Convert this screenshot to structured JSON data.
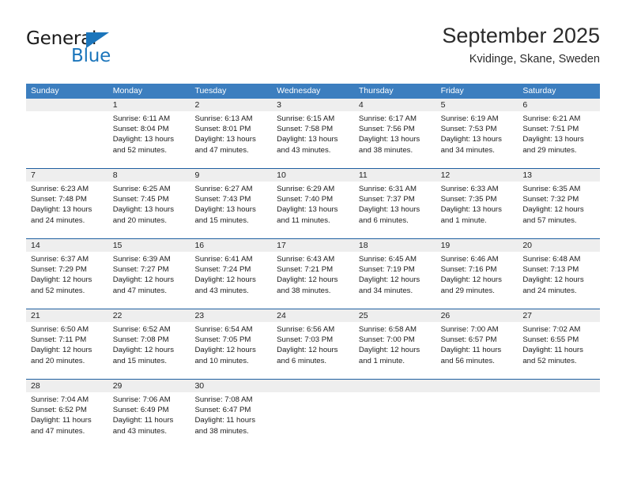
{
  "brand": {
    "name_part1": "General",
    "name_part2": "Blue",
    "accent_color": "#1b75bb"
  },
  "header": {
    "title": "September 2025",
    "location": "Kvidinge, Skane, Sweden"
  },
  "theme": {
    "header_row_bg": "#3c7ebf",
    "week_separator": "#1f5fa0",
    "day_number_bg": "#eeeeee"
  },
  "weekday_headers": [
    "Sunday",
    "Monday",
    "Tuesday",
    "Wednesday",
    "Thursday",
    "Friday",
    "Saturday"
  ],
  "weeks": [
    [
      {
        "day": "",
        "empty": true,
        "sunrise": "",
        "sunset": "",
        "daylight_line1": "",
        "daylight_line2": ""
      },
      {
        "day": "1",
        "sunrise": "Sunrise: 6:11 AM",
        "sunset": "Sunset: 8:04 PM",
        "daylight_line1": "Daylight: 13 hours",
        "daylight_line2": "and 52 minutes."
      },
      {
        "day": "2",
        "sunrise": "Sunrise: 6:13 AM",
        "sunset": "Sunset: 8:01 PM",
        "daylight_line1": "Daylight: 13 hours",
        "daylight_line2": "and 47 minutes."
      },
      {
        "day": "3",
        "sunrise": "Sunrise: 6:15 AM",
        "sunset": "Sunset: 7:58 PM",
        "daylight_line1": "Daylight: 13 hours",
        "daylight_line2": "and 43 minutes."
      },
      {
        "day": "4",
        "sunrise": "Sunrise: 6:17 AM",
        "sunset": "Sunset: 7:56 PM",
        "daylight_line1": "Daylight: 13 hours",
        "daylight_line2": "and 38 minutes."
      },
      {
        "day": "5",
        "sunrise": "Sunrise: 6:19 AM",
        "sunset": "Sunset: 7:53 PM",
        "daylight_line1": "Daylight: 13 hours",
        "daylight_line2": "and 34 minutes."
      },
      {
        "day": "6",
        "sunrise": "Sunrise: 6:21 AM",
        "sunset": "Sunset: 7:51 PM",
        "daylight_line1": "Daylight: 13 hours",
        "daylight_line2": "and 29 minutes."
      }
    ],
    [
      {
        "day": "7",
        "sunrise": "Sunrise: 6:23 AM",
        "sunset": "Sunset: 7:48 PM",
        "daylight_line1": "Daylight: 13 hours",
        "daylight_line2": "and 24 minutes."
      },
      {
        "day": "8",
        "sunrise": "Sunrise: 6:25 AM",
        "sunset": "Sunset: 7:45 PM",
        "daylight_line1": "Daylight: 13 hours",
        "daylight_line2": "and 20 minutes."
      },
      {
        "day": "9",
        "sunrise": "Sunrise: 6:27 AM",
        "sunset": "Sunset: 7:43 PM",
        "daylight_line1": "Daylight: 13 hours",
        "daylight_line2": "and 15 minutes."
      },
      {
        "day": "10",
        "sunrise": "Sunrise: 6:29 AM",
        "sunset": "Sunset: 7:40 PM",
        "daylight_line1": "Daylight: 13 hours",
        "daylight_line2": "and 11 minutes."
      },
      {
        "day": "11",
        "sunrise": "Sunrise: 6:31 AM",
        "sunset": "Sunset: 7:37 PM",
        "daylight_line1": "Daylight: 13 hours",
        "daylight_line2": "and 6 minutes."
      },
      {
        "day": "12",
        "sunrise": "Sunrise: 6:33 AM",
        "sunset": "Sunset: 7:35 PM",
        "daylight_line1": "Daylight: 13 hours",
        "daylight_line2": "and 1 minute."
      },
      {
        "day": "13",
        "sunrise": "Sunrise: 6:35 AM",
        "sunset": "Sunset: 7:32 PM",
        "daylight_line1": "Daylight: 12 hours",
        "daylight_line2": "and 57 minutes."
      }
    ],
    [
      {
        "day": "14",
        "sunrise": "Sunrise: 6:37 AM",
        "sunset": "Sunset: 7:29 PM",
        "daylight_line1": "Daylight: 12 hours",
        "daylight_line2": "and 52 minutes."
      },
      {
        "day": "15",
        "sunrise": "Sunrise: 6:39 AM",
        "sunset": "Sunset: 7:27 PM",
        "daylight_line1": "Daylight: 12 hours",
        "daylight_line2": "and 47 minutes."
      },
      {
        "day": "16",
        "sunrise": "Sunrise: 6:41 AM",
        "sunset": "Sunset: 7:24 PM",
        "daylight_line1": "Daylight: 12 hours",
        "daylight_line2": "and 43 minutes."
      },
      {
        "day": "17",
        "sunrise": "Sunrise: 6:43 AM",
        "sunset": "Sunset: 7:21 PM",
        "daylight_line1": "Daylight: 12 hours",
        "daylight_line2": "and 38 minutes."
      },
      {
        "day": "18",
        "sunrise": "Sunrise: 6:45 AM",
        "sunset": "Sunset: 7:19 PM",
        "daylight_line1": "Daylight: 12 hours",
        "daylight_line2": "and 34 minutes."
      },
      {
        "day": "19",
        "sunrise": "Sunrise: 6:46 AM",
        "sunset": "Sunset: 7:16 PM",
        "daylight_line1": "Daylight: 12 hours",
        "daylight_line2": "and 29 minutes."
      },
      {
        "day": "20",
        "sunrise": "Sunrise: 6:48 AM",
        "sunset": "Sunset: 7:13 PM",
        "daylight_line1": "Daylight: 12 hours",
        "daylight_line2": "and 24 minutes."
      }
    ],
    [
      {
        "day": "21",
        "sunrise": "Sunrise: 6:50 AM",
        "sunset": "Sunset: 7:11 PM",
        "daylight_line1": "Daylight: 12 hours",
        "daylight_line2": "and 20 minutes."
      },
      {
        "day": "22",
        "sunrise": "Sunrise: 6:52 AM",
        "sunset": "Sunset: 7:08 PM",
        "daylight_line1": "Daylight: 12 hours",
        "daylight_line2": "and 15 minutes."
      },
      {
        "day": "23",
        "sunrise": "Sunrise: 6:54 AM",
        "sunset": "Sunset: 7:05 PM",
        "daylight_line1": "Daylight: 12 hours",
        "daylight_line2": "and 10 minutes."
      },
      {
        "day": "24",
        "sunrise": "Sunrise: 6:56 AM",
        "sunset": "Sunset: 7:03 PM",
        "daylight_line1": "Daylight: 12 hours",
        "daylight_line2": "and 6 minutes."
      },
      {
        "day": "25",
        "sunrise": "Sunrise: 6:58 AM",
        "sunset": "Sunset: 7:00 PM",
        "daylight_line1": "Daylight: 12 hours",
        "daylight_line2": "and 1 minute."
      },
      {
        "day": "26",
        "sunrise": "Sunrise: 7:00 AM",
        "sunset": "Sunset: 6:57 PM",
        "daylight_line1": "Daylight: 11 hours",
        "daylight_line2": "and 56 minutes."
      },
      {
        "day": "27",
        "sunrise": "Sunrise: 7:02 AM",
        "sunset": "Sunset: 6:55 PM",
        "daylight_line1": "Daylight: 11 hours",
        "daylight_line2": "and 52 minutes."
      }
    ],
    [
      {
        "day": "28",
        "sunrise": "Sunrise: 7:04 AM",
        "sunset": "Sunset: 6:52 PM",
        "daylight_line1": "Daylight: 11 hours",
        "daylight_line2": "and 47 minutes."
      },
      {
        "day": "29",
        "sunrise": "Sunrise: 7:06 AM",
        "sunset": "Sunset: 6:49 PM",
        "daylight_line1": "Daylight: 11 hours",
        "daylight_line2": "and 43 minutes."
      },
      {
        "day": "30",
        "sunrise": "Sunrise: 7:08 AM",
        "sunset": "Sunset: 6:47 PM",
        "daylight_line1": "Daylight: 11 hours",
        "daylight_line2": "and 38 minutes."
      },
      {
        "day": "",
        "empty": true,
        "sunrise": "",
        "sunset": "",
        "daylight_line1": "",
        "daylight_line2": ""
      },
      {
        "day": "",
        "empty": true,
        "sunrise": "",
        "sunset": "",
        "daylight_line1": "",
        "daylight_line2": ""
      },
      {
        "day": "",
        "empty": true,
        "sunrise": "",
        "sunset": "",
        "daylight_line1": "",
        "daylight_line2": ""
      },
      {
        "day": "",
        "empty": true,
        "sunrise": "",
        "sunset": "",
        "daylight_line1": "",
        "daylight_line2": ""
      }
    ]
  ]
}
